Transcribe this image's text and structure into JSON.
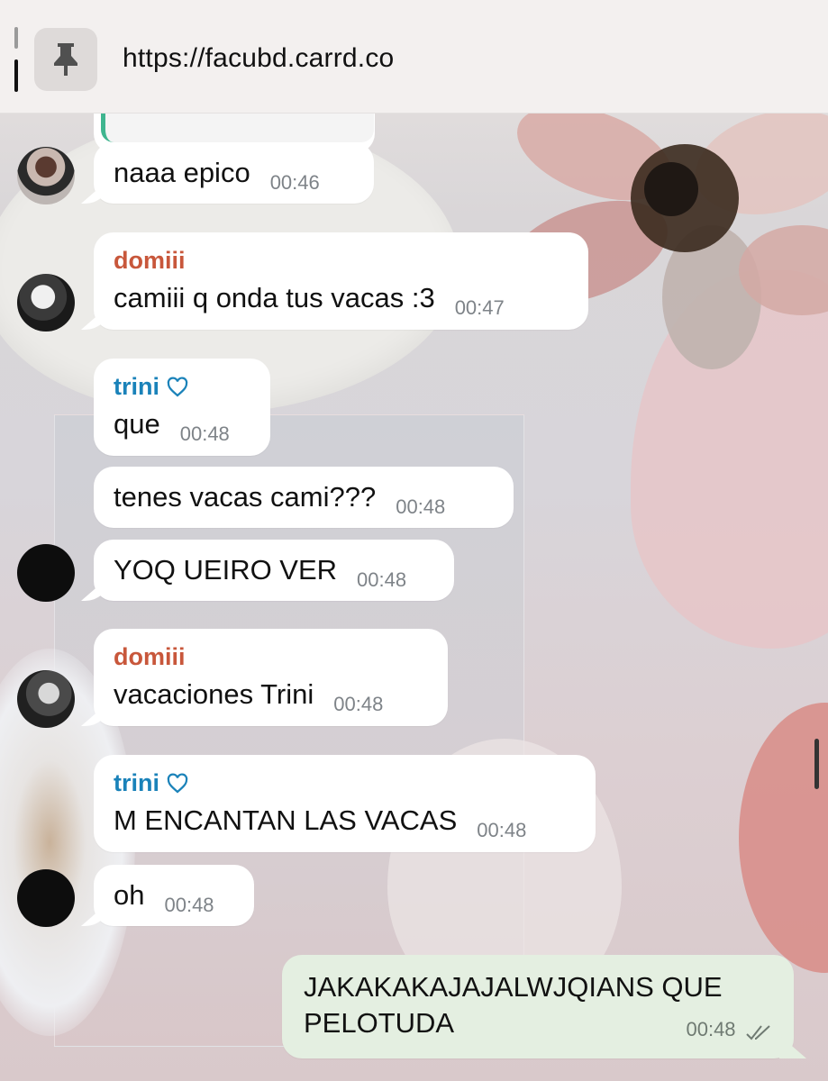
{
  "browser": {
    "url": "https://facubd.carrd.co",
    "pin_icon": "pin-icon"
  },
  "colors": {
    "sender_domiii": "#c8573b",
    "sender_trini": "#1a82b9",
    "incoming_bubble": "#ffffff",
    "outgoing_bubble": "#e4efe1",
    "timestamp": "#7e8388"
  },
  "messages": [
    {
      "text": "naaa epico",
      "time": "00:46"
    },
    {
      "sender": "domiii",
      "text": "camiii q onda tus vacas :3",
      "time": "00:47"
    },
    {
      "sender": "trini",
      "text": "que",
      "time": "00:48"
    },
    {
      "text": "tenes vacas cami???",
      "time": "00:48"
    },
    {
      "text": "YOQ UEIRO VER",
      "time": "00:48"
    },
    {
      "sender": "domiii",
      "text": "vacaciones Trini",
      "time": "00:48"
    },
    {
      "sender": "trini",
      "text": "M ENCANTAN LAS VACAS",
      "time": "00:48"
    },
    {
      "text": "oh",
      "time": "00:48"
    },
    {
      "text_line1": "JAKAKAKAJAJALWJQIANS QUE",
      "text_line2": "PELOTUDA",
      "time": "00:48",
      "status": "read-double-check"
    }
  ]
}
